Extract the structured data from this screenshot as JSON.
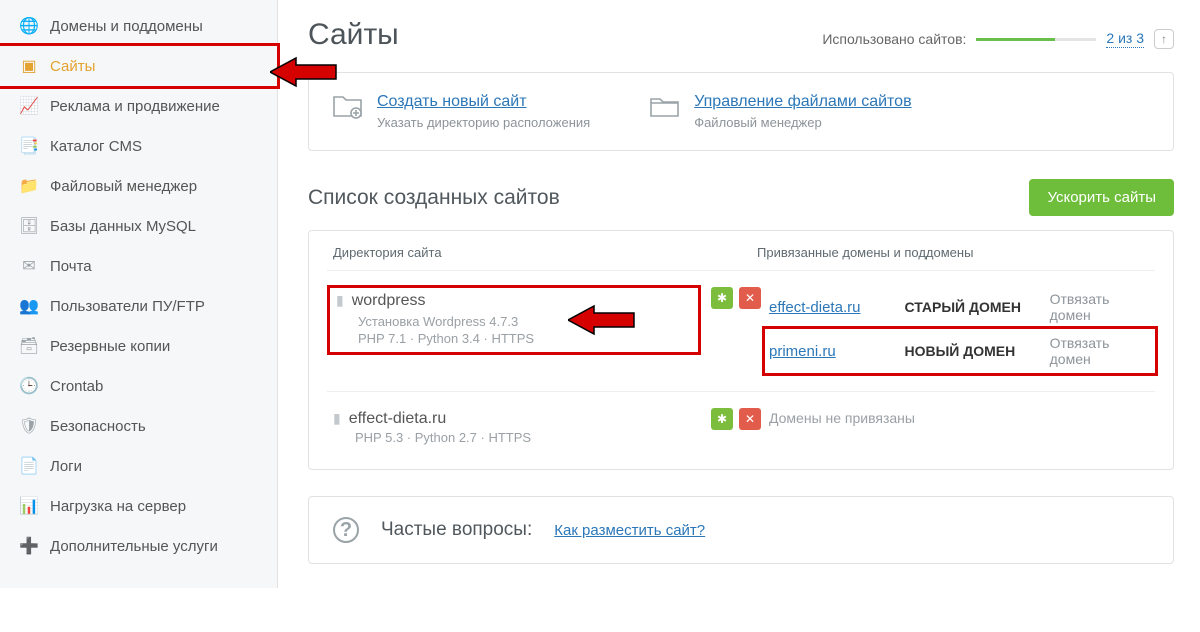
{
  "sidebar": {
    "items": [
      {
        "label": "Домены и поддомены",
        "icon": "🌐"
      },
      {
        "label": "Сайты",
        "icon": "▣"
      },
      {
        "label": "Реклама и продвижение",
        "icon": "📈"
      },
      {
        "label": "Каталог CMS",
        "icon": "📑"
      },
      {
        "label": "Файловый менеджер",
        "icon": "📁"
      },
      {
        "label": "Базы данных MySQL",
        "icon": "🗄"
      },
      {
        "label": "Почта",
        "icon": "✉"
      },
      {
        "label": "Пользователи ПУ/FTP",
        "icon": "👥"
      },
      {
        "label": "Резервные копии",
        "icon": "🗃"
      },
      {
        "label": "Crontab",
        "icon": "🕒"
      },
      {
        "label": "Безопасность",
        "icon": "🛡"
      },
      {
        "label": "Логи",
        "icon": "📄"
      },
      {
        "label": "Нагрузка на сервер",
        "icon": "📊"
      },
      {
        "label": "Дополнительные услуги",
        "icon": "➕"
      }
    ]
  },
  "header": {
    "title": "Сайты",
    "usage_label": "Использовано сайтов:",
    "usage_count": "2 из 3"
  },
  "actions": {
    "create": {
      "title": "Создать новый сайт",
      "sub": "Указать директорию расположения"
    },
    "files": {
      "title": "Управление файлами сайтов",
      "sub": "Файловый менеджер"
    }
  },
  "list": {
    "title": "Список созданных сайтов",
    "speedup": "Ускорить сайты",
    "col_dir": "Директория сайта",
    "col_dom": "Привязанные домены и поддомены",
    "sites": [
      {
        "dir": "wordpress",
        "line2": "Установка Wordpress 4.7.3",
        "line3": "PHP 7.1 · Python 3.4 · HTTPS",
        "highlight": true,
        "domains": [
          {
            "name": "effect-dieta.ru",
            "tag": "СТАРЫЙ ДОМЕН",
            "unbind": "Отвязать домен",
            "hl": false
          },
          {
            "name": "primeni.ru",
            "tag": "НОВЫЙ ДОМЕН",
            "unbind": "Отвязать домен",
            "hl": true
          }
        ]
      },
      {
        "dir": "effect-dieta.ru",
        "line2": "",
        "line3": "PHP 5.3 · Python 2.7 · HTTPS",
        "highlight": false,
        "nodomains": "Домены не привязаны"
      }
    ]
  },
  "faq": {
    "title": "Частые вопросы:",
    "link": "Как разместить сайт?"
  }
}
